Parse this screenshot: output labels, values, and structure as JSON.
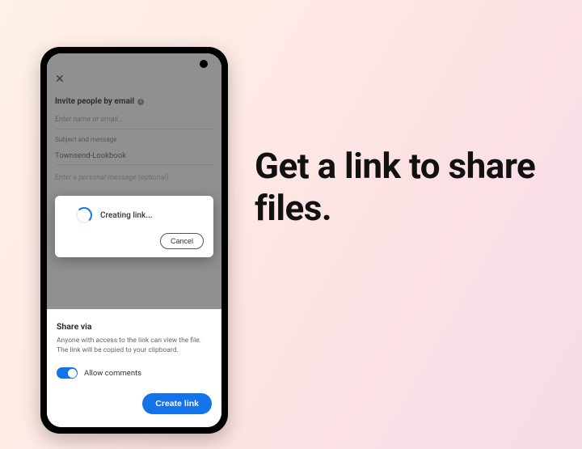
{
  "headline": "Get a link to share files.",
  "background": {
    "invite_label": "Invite people by email",
    "name_placeholder": "Enter name or email...",
    "subject_section": "Subject and message",
    "subject_value": "Townsend-Lookbook",
    "message_placeholder": "Enter a personal message (optional)"
  },
  "modal": {
    "status": "Creating link...",
    "cancel": "Cancel"
  },
  "sheet": {
    "title": "Share via",
    "description": "Anyone with access to the link can view the file. The link will be copied to your clipboard.",
    "allow_comments": "Allow comments",
    "create_link": "Create link"
  }
}
